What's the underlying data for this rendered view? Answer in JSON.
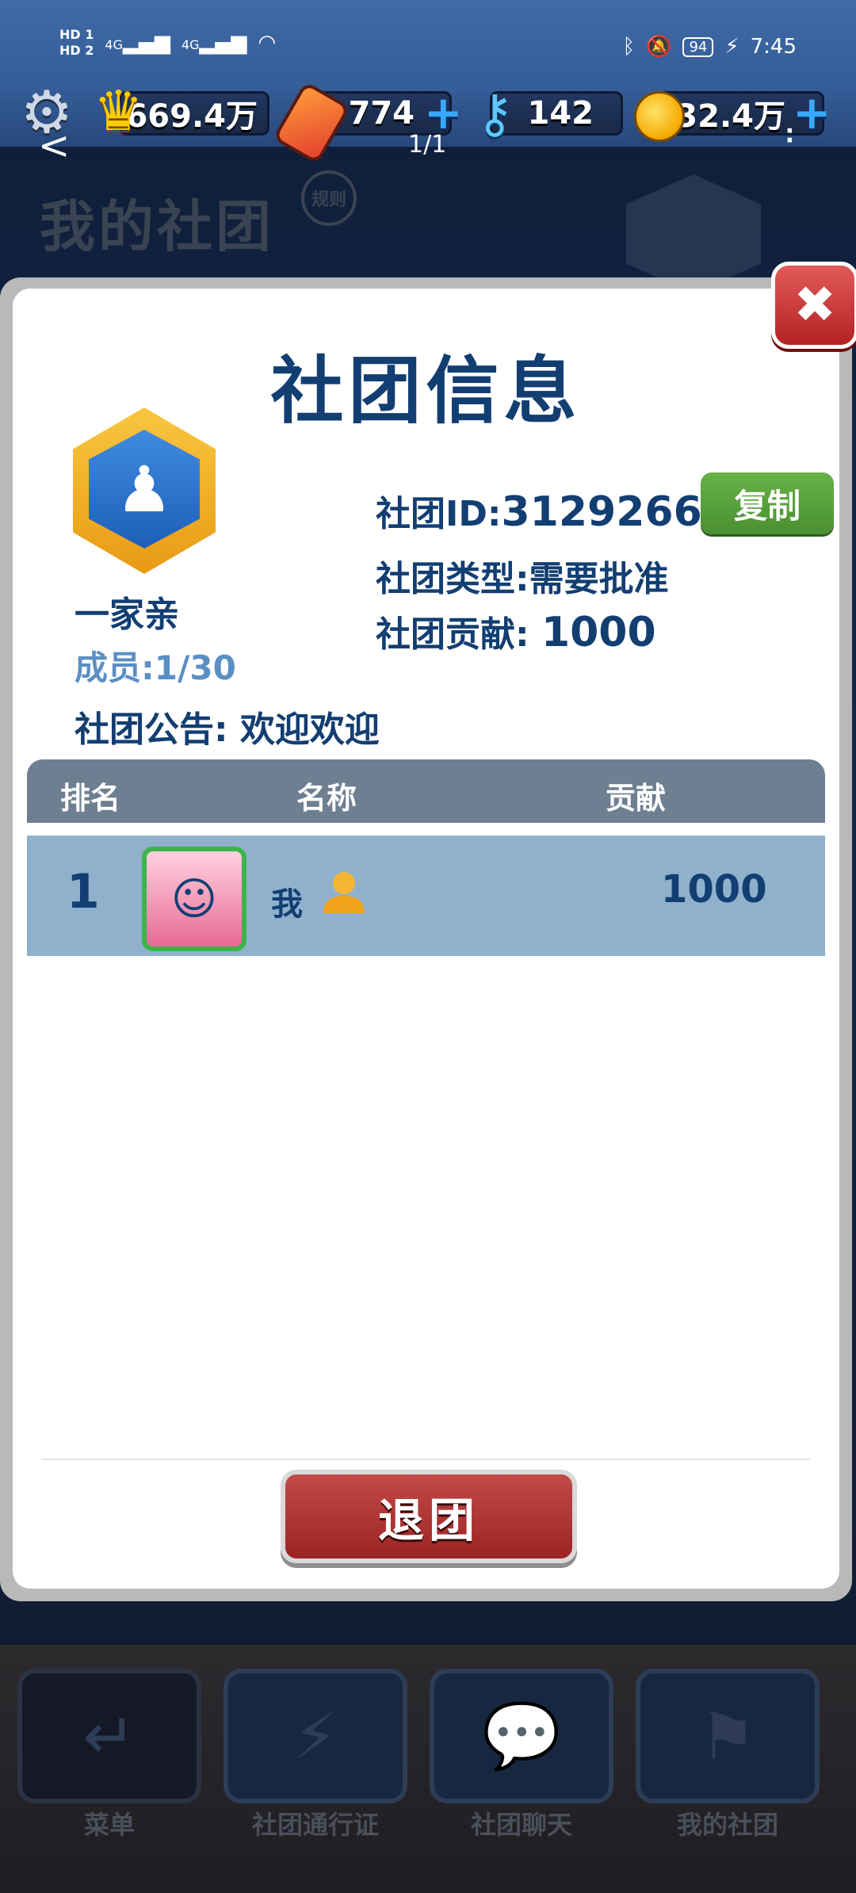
{
  "status_bar": {
    "sim1": "HD 1",
    "sim2": "HD 2",
    "signal1": "4G",
    "signal2": "4G",
    "battery": "94",
    "time": "7:45"
  },
  "resources": {
    "crown_value": "669.4万",
    "ticket_value": "774",
    "key_value": "142",
    "coin_value": "32.4万"
  },
  "header": {
    "page_indicator": "1/1"
  },
  "background": {
    "title": "我的社团",
    "rule_badge": "规则"
  },
  "dialog": {
    "title": "社团信息",
    "club_name": "一家亲",
    "members_label": "成员:1/30",
    "club_id_label": "社团ID:",
    "club_id": "3129266",
    "copy_button": "复制",
    "type_label": "社团类型:",
    "type_value": "需要批准",
    "contribution_label": "社团贡献:",
    "contribution_value": "1000",
    "notice_label": "社团公告:",
    "notice_value": "欢迎欢迎",
    "table_headers": {
      "rank": "排名",
      "name": "名称",
      "contribution": "贡献"
    },
    "members": [
      {
        "rank": "1",
        "name": "我",
        "contribution": "1000"
      }
    ],
    "quit_button": "退团"
  },
  "bottom_nav": [
    {
      "label": "菜单",
      "icon": "return-arrow-icon"
    },
    {
      "label": "社团通行证",
      "icon": "pass-ticket-icon"
    },
    {
      "label": "社团聊天",
      "icon": "chat-bubble-icon"
    },
    {
      "label": "我的社团",
      "icon": "flag-icon"
    }
  ],
  "colors": {
    "title_blue": "#123e72",
    "table_header": "#6e7f91",
    "row_highlight": "#8fb1cc",
    "copy_green": "#5aa23c",
    "quit_red": "#b33333"
  }
}
